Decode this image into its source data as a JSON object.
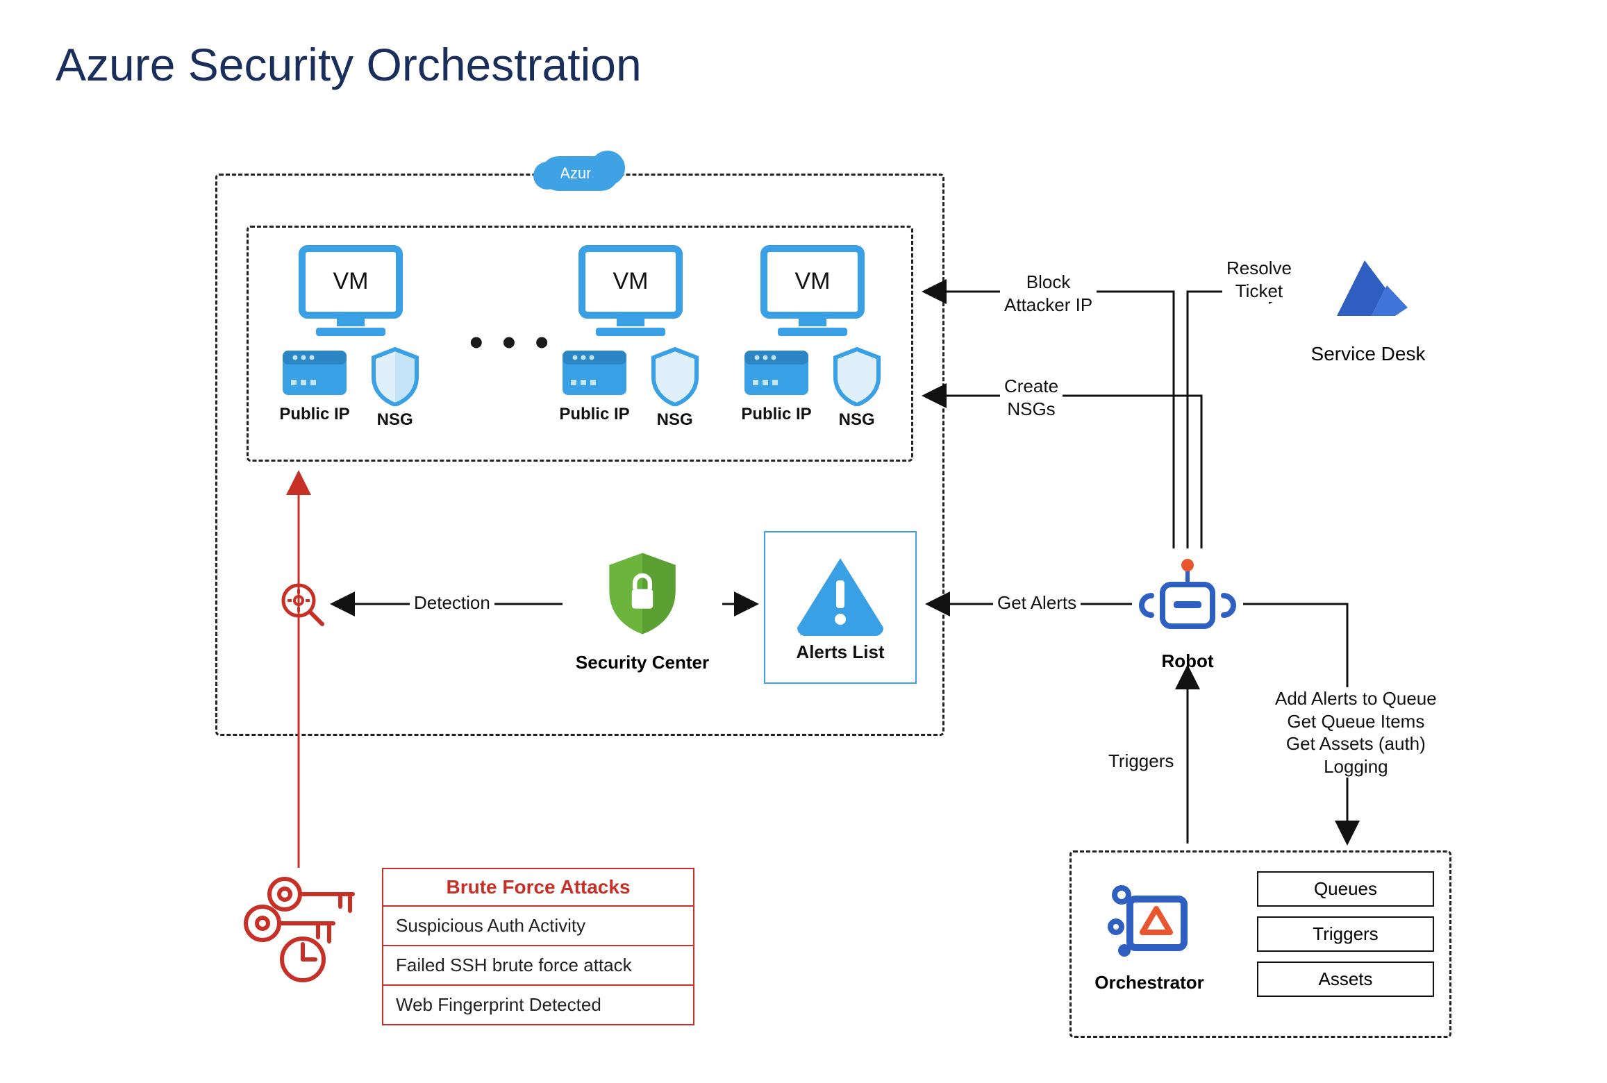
{
  "title": "Azure Security Orchestration",
  "azure": {
    "badge": "Azure",
    "vm_label": "VM",
    "public_ip_label": "Public IP",
    "nsg_label": "NSG",
    "ellipsis": "• • •"
  },
  "security_center": {
    "label": "Security Center"
  },
  "alerts_list": {
    "label": "Alerts List"
  },
  "robot": {
    "label": "Robot"
  },
  "service_desk": {
    "label": "Service Desk"
  },
  "orchestrator": {
    "label": "Orchestrator",
    "items": [
      "Queues",
      "Triggers",
      "Assets"
    ]
  },
  "attacks": {
    "header": "Brute Force Attacks",
    "rows": [
      "Suspicious Auth Activity",
      "Failed SSH brute force attack",
      "Web Fingerprint Detected"
    ]
  },
  "edges": {
    "detection": "Detection",
    "get_alerts": "Get Alerts",
    "block_attacker": "Block\nAttacker IP",
    "create_nsgs": "Create\nNSGs",
    "resolve_ticket": "Resolve\nTicket",
    "triggers": "Triggers",
    "queue_block": "Add Alerts to Queue\nGet Queue Items\nGet Assets (auth)\nLogging"
  }
}
